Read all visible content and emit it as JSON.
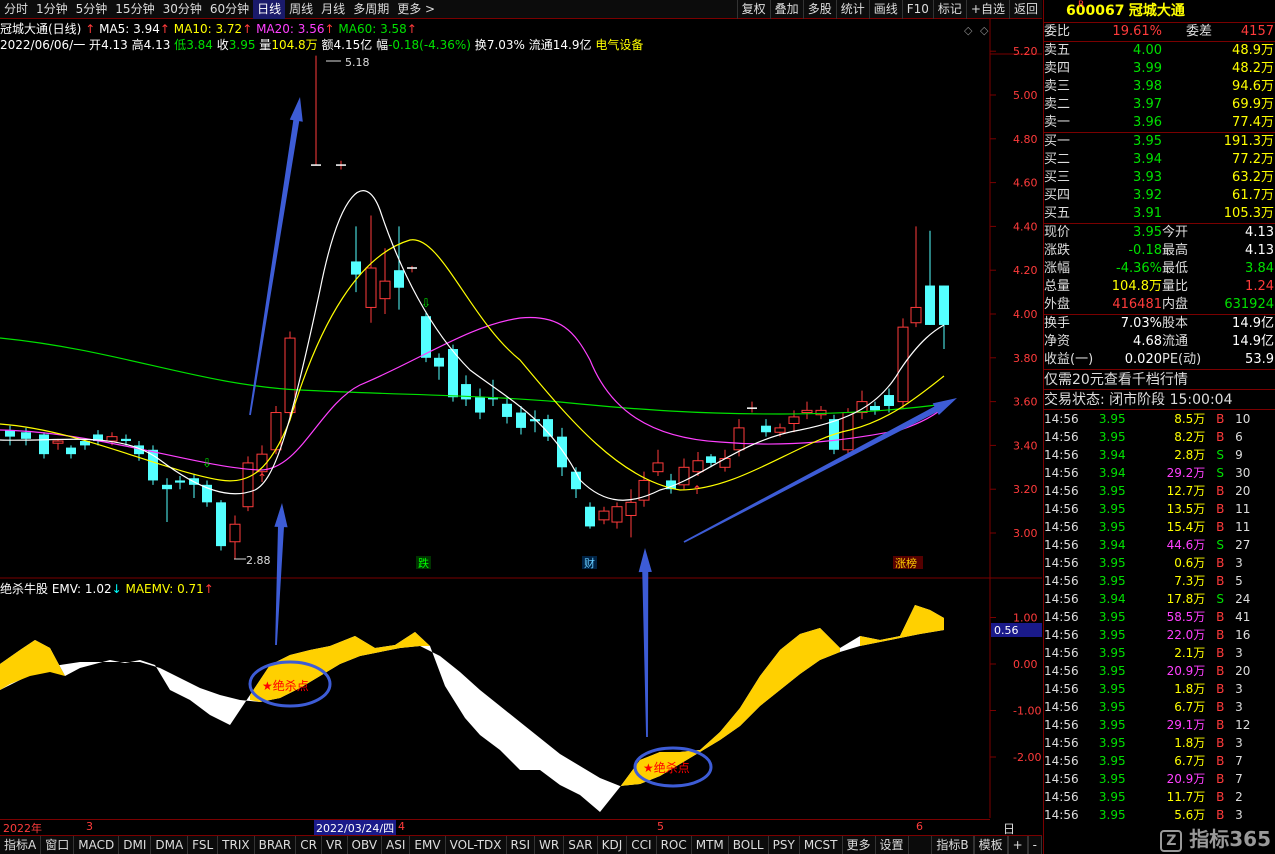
{
  "top_tabs": [
    {
      "label": "分时",
      "active": false
    },
    {
      "label": "1分钟",
      "active": false
    },
    {
      "label": "5分钟",
      "active": false
    },
    {
      "label": "15分钟",
      "active": false
    },
    {
      "label": "30分钟",
      "active": false
    },
    {
      "label": "60分钟",
      "active": false
    },
    {
      "label": "日线",
      "active": true
    },
    {
      "label": "周线",
      "active": false
    },
    {
      "label": "月线",
      "active": false
    },
    {
      "label": "多周期",
      "active": false
    },
    {
      "label": "更多 >",
      "active": false
    }
  ],
  "right_tools": [
    "复权",
    "叠加",
    "多股",
    "统计",
    "画线",
    "F10",
    "标记",
    "+自选",
    "返回"
  ],
  "chart_header": {
    "title": "冠城大通(日线)",
    "ma5": "MA5: 3.94",
    "ma10": "MA10: 3.72",
    "ma20": "MA20: 3.56",
    "ma60": "MA60: 3.58",
    "date": "2022/06/06/一",
    "open_label": "开",
    "open": "4.13",
    "high_label": "高",
    "high": "4.13",
    "low_label": "低",
    "low": "3.84",
    "close_label": "收",
    "close": "3.95",
    "vol_label": "量",
    "vol": "104.8万",
    "amt_label": "额",
    "amt": "4.15亿",
    "chg_label": "幅",
    "chg": "-0.18(-4.36%)",
    "turn_label": "换",
    "turn": "7.03%",
    "float_label": "流通",
    "float": "14.9亿",
    "sector": "电气设备"
  },
  "price_axis": [
    "5.20",
    "5.00",
    "4.80",
    "4.60",
    "4.40",
    "4.20",
    "4.00",
    "3.80",
    "3.60",
    "3.40",
    "3.20",
    "3.00"
  ],
  "high_mark": "5.18",
  "low_mark": "2.88",
  "event_tags": [
    "跌",
    "财",
    "涨榜"
  ],
  "indicator_header": {
    "name": "绝杀牛股",
    "emv": "EMV: 1.02",
    "maemv": "MAEMV: 0.71"
  },
  "indicator_axis": [
    "1.00",
    "0.00",
    "-1.00",
    "-2.00"
  ],
  "indicator_current": "0.56",
  "signal_label": "绝杀点",
  "dates": {
    "year": "2022年",
    "m3": "3",
    "cursor": "2022/03/24/四",
    "m4": "4",
    "m5": "5",
    "m6": "6",
    "period": "日线"
  },
  "bottom_tabs": [
    "指标A",
    "窗口",
    "MACD",
    "DMI",
    "DMA",
    "FSL",
    "TRIX",
    "BRAR",
    "CR",
    "VR",
    "OBV",
    "ASI",
    "EMV",
    "VOL-TDX",
    "RSI",
    "WR",
    "SAR",
    "KDJ",
    "CCI",
    "ROC",
    "MTM",
    "BOLL",
    "PSY",
    "MCST",
    "更多",
    "设置"
  ],
  "bottom_right_tabs": [
    "指标B",
    "模板",
    "+",
    "-"
  ],
  "quote": {
    "code": "600067",
    "name": "冠城大通",
    "webi_label": "委比",
    "webi": "19.61%",
    "weicha_label": "委差",
    "weicha": "4157",
    "asks": [
      {
        "label": "卖五",
        "price": "4.00",
        "vol": "48.9万"
      },
      {
        "label": "卖四",
        "price": "3.99",
        "vol": "48.2万"
      },
      {
        "label": "卖三",
        "price": "3.98",
        "vol": "94.6万"
      },
      {
        "label": "卖二",
        "price": "3.97",
        "vol": "69.9万"
      },
      {
        "label": "卖一",
        "price": "3.96",
        "vol": "77.4万"
      }
    ],
    "bids": [
      {
        "label": "买一",
        "price": "3.95",
        "vol": "191.3万"
      },
      {
        "label": "买二",
        "price": "3.94",
        "vol": "77.2万"
      },
      {
        "label": "买三",
        "price": "3.93",
        "vol": "63.2万"
      },
      {
        "label": "买四",
        "price": "3.92",
        "vol": "61.7万"
      },
      {
        "label": "买五",
        "price": "3.91",
        "vol": "105.3万"
      }
    ],
    "stats": [
      {
        "l1": "现价",
        "v1": "3.95",
        "l2": "今开",
        "v2": "4.13"
      },
      {
        "l1": "涨跌",
        "v1": "-0.18",
        "l2": "最高",
        "v2": "4.13"
      },
      {
        "l1": "涨幅",
        "v1": "-4.36%",
        "l2": "最低",
        "v2": "3.84"
      },
      {
        "l1": "总量",
        "v1": "104.8万",
        "l2": "量比",
        "v2": "1.24"
      },
      {
        "l1": "外盘",
        "v1": "416481",
        "l2": "内盘",
        "v2": "631924"
      }
    ],
    "stats2": [
      {
        "l1": "换手",
        "v1": "7.03%",
        "l2": "股本",
        "v2": "14.9亿"
      },
      {
        "l1": "净资",
        "v1": "4.68",
        "l2": "流通",
        "v2": "14.9亿"
      },
      {
        "l1": "收益(一)",
        "v1": "0.020",
        "l2": "PE(动)",
        "v2": "53.9"
      }
    ],
    "promo": "仅需20元查看千档行情",
    "status": "交易状态: 闭市阶段 15:00:04",
    "ticks": [
      {
        "t": "14:56",
        "p": "3.95",
        "v": "8.5万",
        "d": "B",
        "n": "10"
      },
      {
        "t": "14:56",
        "p": "3.95",
        "v": "8.2万",
        "d": "B",
        "n": "6"
      },
      {
        "t": "14:56",
        "p": "3.94",
        "v": "2.8万",
        "d": "S",
        "n": "9"
      },
      {
        "t": "14:56",
        "p": "3.94",
        "v": "29.2万",
        "d": "S",
        "n": "30"
      },
      {
        "t": "14:56",
        "p": "3.95",
        "v": "12.7万",
        "d": "B",
        "n": "20"
      },
      {
        "t": "14:56",
        "p": "3.95",
        "v": "13.5万",
        "d": "B",
        "n": "11"
      },
      {
        "t": "14:56",
        "p": "3.95",
        "v": "15.4万",
        "d": "B",
        "n": "11"
      },
      {
        "t": "14:56",
        "p": "3.94",
        "v": "44.6万",
        "d": "S",
        "n": "27"
      },
      {
        "t": "14:56",
        "p": "3.95",
        "v": "0.6万",
        "d": "B",
        "n": "3"
      },
      {
        "t": "14:56",
        "p": "3.95",
        "v": "7.3万",
        "d": "B",
        "n": "5"
      },
      {
        "t": "14:56",
        "p": "3.94",
        "v": "17.8万",
        "d": "S",
        "n": "24"
      },
      {
        "t": "14:56",
        "p": "3.95",
        "v": "58.5万",
        "d": "B",
        "n": "41"
      },
      {
        "t": "14:56",
        "p": "3.95",
        "v": "22.0万",
        "d": "B",
        "n": "16"
      },
      {
        "t": "14:56",
        "p": "3.95",
        "v": "2.1万",
        "d": "B",
        "n": "3"
      },
      {
        "t": "14:56",
        "p": "3.95",
        "v": "20.9万",
        "d": "B",
        "n": "20"
      },
      {
        "t": "14:56",
        "p": "3.95",
        "v": "1.8万",
        "d": "B",
        "n": "3"
      },
      {
        "t": "14:56",
        "p": "3.95",
        "v": "6.7万",
        "d": "B",
        "n": "3"
      },
      {
        "t": "14:56",
        "p": "3.95",
        "v": "29.1万",
        "d": "B",
        "n": "12"
      },
      {
        "t": "14:56",
        "p": "3.95",
        "v": "1.8万",
        "d": "B",
        "n": "3"
      },
      {
        "t": "14:56",
        "p": "3.95",
        "v": "6.7万",
        "d": "B",
        "n": "7"
      },
      {
        "t": "14:56",
        "p": "3.95",
        "v": "20.9万",
        "d": "B",
        "n": "7"
      },
      {
        "t": "14:56",
        "p": "3.95",
        "v": "11.7万",
        "d": "B",
        "n": "2"
      },
      {
        "t": "14:56",
        "p": "3.95",
        "v": "5.6万",
        "d": "B",
        "n": "3"
      }
    ],
    "watermark": "指标365"
  },
  "colors": {
    "up": "#ff3b3b",
    "down": "#54ffff",
    "ma5": "#ffffff",
    "ma10": "#ffff00",
    "ma20": "#ff40ff",
    "ma60": "#00e000",
    "emv": "#ffd000",
    "arrow": "#3d5cd6"
  }
}
